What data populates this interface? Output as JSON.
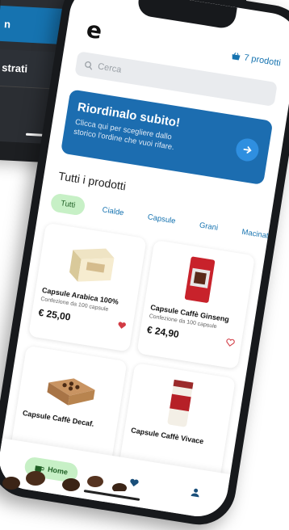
{
  "background_device": {
    "row1_text": "n",
    "row2_text": "strati"
  },
  "app": {
    "logo_letter": "e",
    "cart_label": "7 prodotti",
    "search_placeholder": "Cerca",
    "banner": {
      "title": "Riordinalo subito!",
      "subtitle": "Clicca qui per scegliere dallo storico l'ordine che vuoi rifare."
    },
    "section_title": "Tutti i prodotti",
    "categories": [
      "Tutti",
      "Cialde",
      "Capsule",
      "Grani",
      "Macinato"
    ],
    "active_category": "Tutti",
    "products": [
      {
        "name": "Capsule Arabica 100%",
        "desc": "Confezione da 100 capsule",
        "price": "€ 25,00",
        "favorite": true
      },
      {
        "name": "Capsule Caffè Ginseng",
        "desc": "Confezione da 100 capsule",
        "price": "€ 24,90",
        "favorite": false
      },
      {
        "name": "Capsule Caffè Decaf.",
        "desc": "",
        "price": "",
        "favorite": false
      },
      {
        "name": "Capsule Caffè Vivace",
        "desc": "",
        "price": "",
        "favorite": false
      }
    ],
    "nav": {
      "home_label": "Home"
    }
  },
  "colors": {
    "brand_blue": "#1673b0",
    "banner_blue": "#1c6db0",
    "chip_green": "#c7f0c6",
    "heart_red": "#d23b44"
  }
}
